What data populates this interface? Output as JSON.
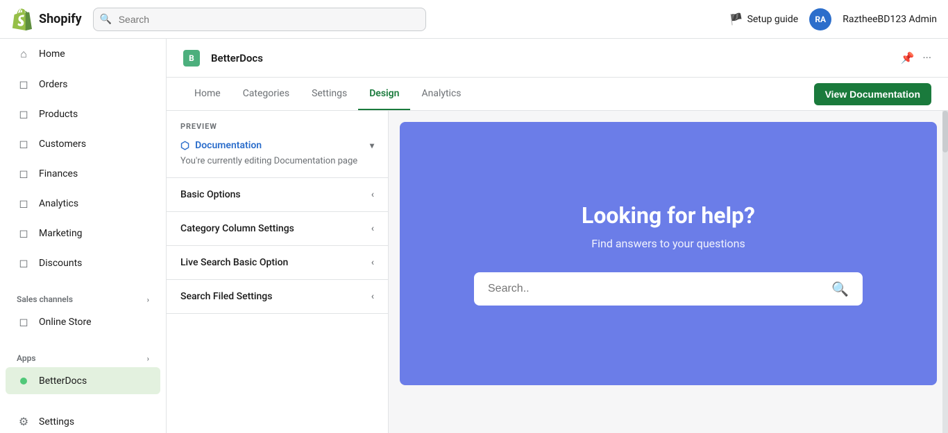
{
  "topNav": {
    "brandName": "shopify",
    "searchPlaceholder": "Search",
    "setupGuide": "Setup guide",
    "userName": "RaztheeBD123 Admin",
    "userInitials": "RA"
  },
  "sidebar": {
    "items": [
      {
        "id": "home",
        "label": "Home",
        "icon": "⌂"
      },
      {
        "id": "orders",
        "label": "Orders",
        "icon": "📋"
      },
      {
        "id": "products",
        "label": "Products",
        "icon": "📦"
      },
      {
        "id": "customers",
        "label": "Customers",
        "icon": "👤"
      },
      {
        "id": "finances",
        "label": "Finances",
        "icon": "🏛"
      },
      {
        "id": "analytics",
        "label": "Analytics",
        "icon": "📊"
      },
      {
        "id": "marketing",
        "label": "Marketing",
        "icon": "📣"
      },
      {
        "id": "discounts",
        "label": "Discounts",
        "icon": "🏷"
      }
    ],
    "salesChannels": {
      "label": "Sales channels",
      "items": [
        {
          "id": "online-store",
          "label": "Online Store",
          "icon": "🏪"
        }
      ]
    },
    "apps": {
      "label": "Apps",
      "items": [
        {
          "id": "betterdocs",
          "label": "BetterDocs",
          "icon": "●"
        }
      ]
    },
    "bottomItems": [
      {
        "id": "settings",
        "label": "Settings",
        "icon": "⚙"
      }
    ]
  },
  "appHeader": {
    "title": "BetterDocs",
    "logoText": "B"
  },
  "tabs": {
    "items": [
      {
        "id": "home",
        "label": "Home"
      },
      {
        "id": "categories",
        "label": "Categories"
      },
      {
        "id": "settings",
        "label": "Settings"
      },
      {
        "id": "design",
        "label": "Design",
        "active": true
      },
      {
        "id": "analytics",
        "label": "Analytics"
      }
    ],
    "viewDocsButton": "View Documentation"
  },
  "leftPanel": {
    "previewLabel": "PREVIEW",
    "previewLinkText": "Documentation",
    "previewDescription": "You're currently editing Documentation page",
    "accordionItems": [
      {
        "id": "basic-options",
        "label": "Basic Options"
      },
      {
        "id": "category-column-settings",
        "label": "Category Column Settings"
      },
      {
        "id": "live-search-basic-option",
        "label": "Live Search Basic Option"
      },
      {
        "id": "search-filed-settings",
        "label": "Search Filed Settings"
      }
    ]
  },
  "rightPreview": {
    "title": "Looking for help?",
    "subtitle": "Find answers to your questions",
    "searchPlaceholder": "Search..",
    "bgColor": "#6b7de8"
  }
}
